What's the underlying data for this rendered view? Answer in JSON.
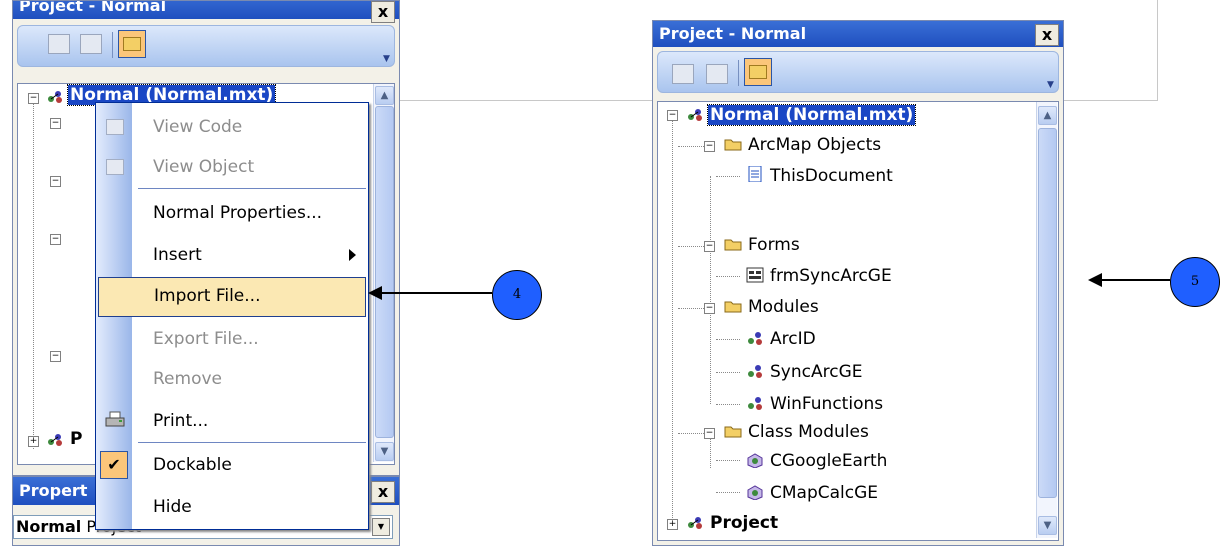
{
  "left_panel": {
    "title": "Project - Normal",
    "close_label": "x",
    "tree_root_label": "Normal (Normal.mxt)",
    "second_root_partial": "P"
  },
  "context_menu": {
    "items": [
      {
        "label": "View Code",
        "enabled": false,
        "icon": "view-code-icon"
      },
      {
        "label": "View Object",
        "enabled": false,
        "icon": "view-object-icon"
      },
      {
        "label": "Normal Properties...",
        "enabled": true
      },
      {
        "label": "Insert",
        "enabled": true,
        "submenu": true
      },
      {
        "label": "Import File...",
        "enabled": true,
        "highlighted": true
      },
      {
        "label": "Export File...",
        "enabled": false
      },
      {
        "label": "Remove",
        "enabled": false
      },
      {
        "label": "Print...",
        "enabled": true,
        "icon": "print-icon"
      },
      {
        "label": "Dockable",
        "enabled": true,
        "checked": true
      },
      {
        "label": "Hide",
        "enabled": true
      }
    ]
  },
  "properties_panel": {
    "title": "Propert",
    "close_label": "x",
    "dropdown_bold": "Normal",
    "dropdown_rest": " Project"
  },
  "right_panel": {
    "title": "Project - Normal",
    "close_label": "x",
    "tree": {
      "root": "Normal (Normal.mxt)",
      "folders": [
        {
          "label": "ArcMap Objects",
          "children": [
            "ThisDocument"
          ]
        },
        {
          "label": "Forms",
          "children": [
            "frmSyncArcGE"
          ]
        },
        {
          "label": "Modules",
          "children": [
            "ArcID",
            "SyncArcGE",
            "WinFunctions"
          ]
        },
        {
          "label": "Class Modules",
          "children": [
            "CGoogleEarth",
            "CMapCalcGE"
          ]
        }
      ],
      "second_root": "Project"
    }
  },
  "callouts": {
    "left": "4",
    "right": "5"
  },
  "colors": {
    "title_bar": "#1f4fbf",
    "selection": "#1a47c5",
    "menu_highlight": "#fbe8b3",
    "callout": "#1f5fff"
  }
}
